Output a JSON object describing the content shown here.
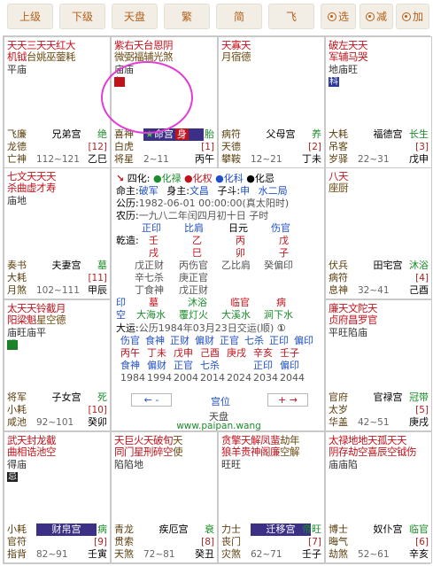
{
  "toolbar": {
    "buttons": [
      "上级",
      "下级",
      "天盘",
      "繁",
      "简",
      "飞",
      "选",
      "减",
      "加"
    ]
  },
  "palaces": [
    {
      "id": "si",
      "l1": [
        [
          "天天",
          "major"
        ],
        [
          "三天天红大",
          "minor"
        ]
      ],
      "l2": [
        [
          "机钺",
          "major"
        ],
        [
          "台姚巫蓥耗",
          "misc"
        ]
      ],
      "bright": "平庙",
      "hua": "",
      "left1": "飞廉",
      "left2": "龙德",
      "left3": "亡神",
      "name": "兄弟宫",
      "cs": "绝",
      "num": "[12]",
      "age": "112~121",
      "gz": "乙巳"
    },
    {
      "id": "wu",
      "l1": [
        [
          "紫右天台恩阴",
          "minor"
        ]
      ],
      "l2": [
        [
          "微弼福辅光煞",
          "misc"
        ]
      ],
      "bright": "庙庙",
      "hua": "权",
      "huaColor": "red",
      "left1": "喜神",
      "left2": "白虎",
      "left3": "将星",
      "name": "命宫",
      "shen": "身",
      "cs": "胎",
      "num": "[1]",
      "age": "2~11",
      "gz": "丙午"
    },
    {
      "id": "wei",
      "l1": [
        [
          "天寡天",
          "minor"
        ]
      ],
      "l2": [
        [
          "月宿德",
          "misc"
        ]
      ],
      "bright": "",
      "hua": "",
      "left1": "病符",
      "left2": "天德",
      "left3": "攀鞍",
      "name": "父母宫",
      "cs": "养",
      "num": "[2]",
      "age": "12~21",
      "gz": "丁未"
    },
    {
      "id": "shen",
      "l1": [
        [
          "破左天天",
          "major"
        ]
      ],
      "l2": [
        [
          "军辅马哭",
          "minor"
        ]
      ],
      "bright": "地庙旺",
      "hua": "科",
      "huaColor": "blue",
      "left1": "大耗",
      "left2": "吊客",
      "left3": "岁驿",
      "name": "福德宫",
      "cs": "长生",
      "num": "[3]",
      "age": "22~31",
      "gz": "戊申"
    },
    {
      "id": "chen",
      "l1": [
        [
          "七文天天天",
          "major"
        ]
      ],
      "l2": [
        [
          "杀曲虚才寿",
          "minor"
        ]
      ],
      "bright": "庙地",
      "hua": "",
      "left1": "奏书",
      "left2": "大耗",
      "left3": "月煞",
      "name": "夫妻宫",
      "cs": "墓",
      "num": "[11]",
      "age": "102~111",
      "gz": "甲辰"
    },
    {
      "id": "you",
      "l1": [
        [
          "八天",
          "minor"
        ]
      ],
      "l2": [
        [
          "座厨",
          "misc"
        ]
      ],
      "bright": "",
      "hua": "",
      "left1": "伏兵",
      "left2": "病符",
      "left3": "息神",
      "name": "田宅宫",
      "cs": "沐浴",
      "num": "[4]",
      "age": "32~41",
      "gz": "己酉"
    },
    {
      "id": "mao",
      "l1": [
        [
          "太天天",
          "major"
        ],
        [
          "铃截月",
          "minor"
        ]
      ],
      "l2": [
        [
          "阳梁魁",
          "major"
        ],
        [
          "星空德",
          "misc"
        ]
      ],
      "bright": "庙旺庙平",
      "hua": "禄",
      "huaColor": "green",
      "left1": "将军",
      "left2": "小耗",
      "left3": "咸池",
      "name": "子女宫",
      "cs": "死",
      "num": "[10]",
      "age": "92~101",
      "gz": "癸卯"
    },
    {
      "id": "xu",
      "l1": [
        [
          "廉天文",
          "major"
        ],
        [
          "陀天",
          "minor"
        ]
      ],
      "l2": [
        [
          "贞府昌",
          "major"
        ],
        [
          "罗官",
          "minor"
        ]
      ],
      "bright": "平旺陷庙",
      "hua": "",
      "left1": "官府",
      "left2": "太岁",
      "left3": "华盖",
      "name": "官禄宫",
      "cs": "冠带",
      "num": "[5]",
      "age": "42~51",
      "gz": "庚戌"
    },
    {
      "id": "yin",
      "l1": [
        [
          "武天封龙截",
          "major"
        ]
      ],
      "l2": [
        [
          "曲相诰池空",
          "minor"
        ]
      ],
      "bright": "得庙",
      "hua": "忌",
      "huaColor": "black",
      "left1": "小耗",
      "left2": "官符",
      "left3": "指背",
      "name": "财帛宫",
      "hl": true,
      "cs": "病",
      "num": "[9]",
      "age": "82~91",
      "gz": "壬寅"
    },
    {
      "id": "chou",
      "l1": [
        [
          "天巨",
          "major"
        ],
        [
          "火天破旬",
          "minor"
        ],
        [
          "天",
          "misc"
        ]
      ],
      "l2": [
        [
          "同门",
          "major"
        ],
        [
          "星刑碎空",
          "minor"
        ],
        [
          "使",
          "misc"
        ]
      ],
      "bright": "陷陷地",
      "hua": "",
      "left1": "青龙",
      "left2": "贯索",
      "left3": "天煞",
      "name": "疾厄宫",
      "cs": "衰",
      "num": "[8]",
      "age": "72~81",
      "gz": "癸丑"
    },
    {
      "id": "zi",
      "l1": [
        [
          "贪",
          "major"
        ],
        [
          "擎天解凤蜚",
          "minor"
        ],
        [
          "劫年",
          "misc"
        ]
      ],
      "l2": [
        [
          "狼",
          "major"
        ],
        [
          "羊贵神阁廉",
          "minor"
        ],
        [
          "空解",
          "misc"
        ]
      ],
      "bright": "旺旺",
      "hua": "",
      "left1": "力士",
      "left2": "丧门",
      "left3": "灾煞",
      "name": "迁移宫",
      "hl": true,
      "cs": "帝旺",
      "num": "[7]",
      "age": "62~71",
      "gz": "壬子"
    },
    {
      "id": "hai",
      "l1": [
        [
          "太",
          "major"
        ],
        [
          "禄地地天孤天天",
          "minor"
        ]
      ],
      "l2": [
        [
          "阴",
          "major"
        ],
        [
          "存劫空喜辰空钺伤",
          "minor"
        ]
      ],
      "bright": "庙庙陷",
      "hua": "",
      "left1": "博士",
      "left2": "晦气",
      "left3": "劫煞",
      "name": "奴仆宫",
      "cs": "临官",
      "num": "[6]",
      "age": "52~61",
      "gz": "辛亥"
    }
  ],
  "center": {
    "sihua": {
      "label": "四化:",
      "lu": "化禄",
      "quan": "化权",
      "ke": "化科",
      "ji": "化忌"
    },
    "ming": "命主:",
    "mingStar": "破军",
    "shen": "身主:",
    "shenStar": "文昌",
    "zidou": "子斗:",
    "zidouVal": "申",
    "ju": "水二局",
    "gongli": "公历:",
    "gongliVal": "1982-06-01 00:00:00(真太阳时)",
    "nongli": "农历:",
    "nongliVal": "一九八二年闰四月初十日 子时",
    "shishen": [
      "正印",
      "比肩",
      "日元",
      "伤官"
    ],
    "qianzao": "乾造:",
    "tiangan": [
      "壬",
      "乙",
      "丙",
      "戊"
    ],
    "dizhi": [
      "戌",
      "巳",
      "卯",
      "子"
    ],
    "cang1": [
      "戊正财",
      "丙伤官",
      "乙比肩",
      "癸偏印"
    ],
    "cang2": [
      "辛七杀",
      "庚正官"
    ],
    "cang3": [
      "丁食神",
      "戊正财"
    ],
    "xiangshen": [
      "印",
      "墓",
      "沐浴",
      "临官",
      "病"
    ],
    "kong": "空",
    "nayin": [
      "大海水",
      "覆灯火",
      "大溪水",
      "涧下水"
    ],
    "dayun": "大运:",
    "dayunVal": "公历1984年03月23日交运(顺)",
    "dy1": [
      "伤官",
      "食神",
      "正财",
      "偏财",
      "正官",
      "七杀",
      "正印",
      "偏印"
    ],
    "dy2": [
      "丙午",
      "丁未",
      "戊申",
      "己酉",
      "庚戌",
      "辛亥",
      "壬子"
    ],
    "dy3": [
      "食神",
      "偏财",
      "正官",
      "七杀",
      "正印",
      "偏印"
    ],
    "years": [
      "1984",
      "1994",
      "2004",
      "2014",
      "2024",
      "2034",
      "2044"
    ],
    "navLeft": "← -",
    "navRight": "+ →",
    "gongwei": "宫位",
    "tianpan": "天盘",
    "website": "www.paipan.wang"
  }
}
